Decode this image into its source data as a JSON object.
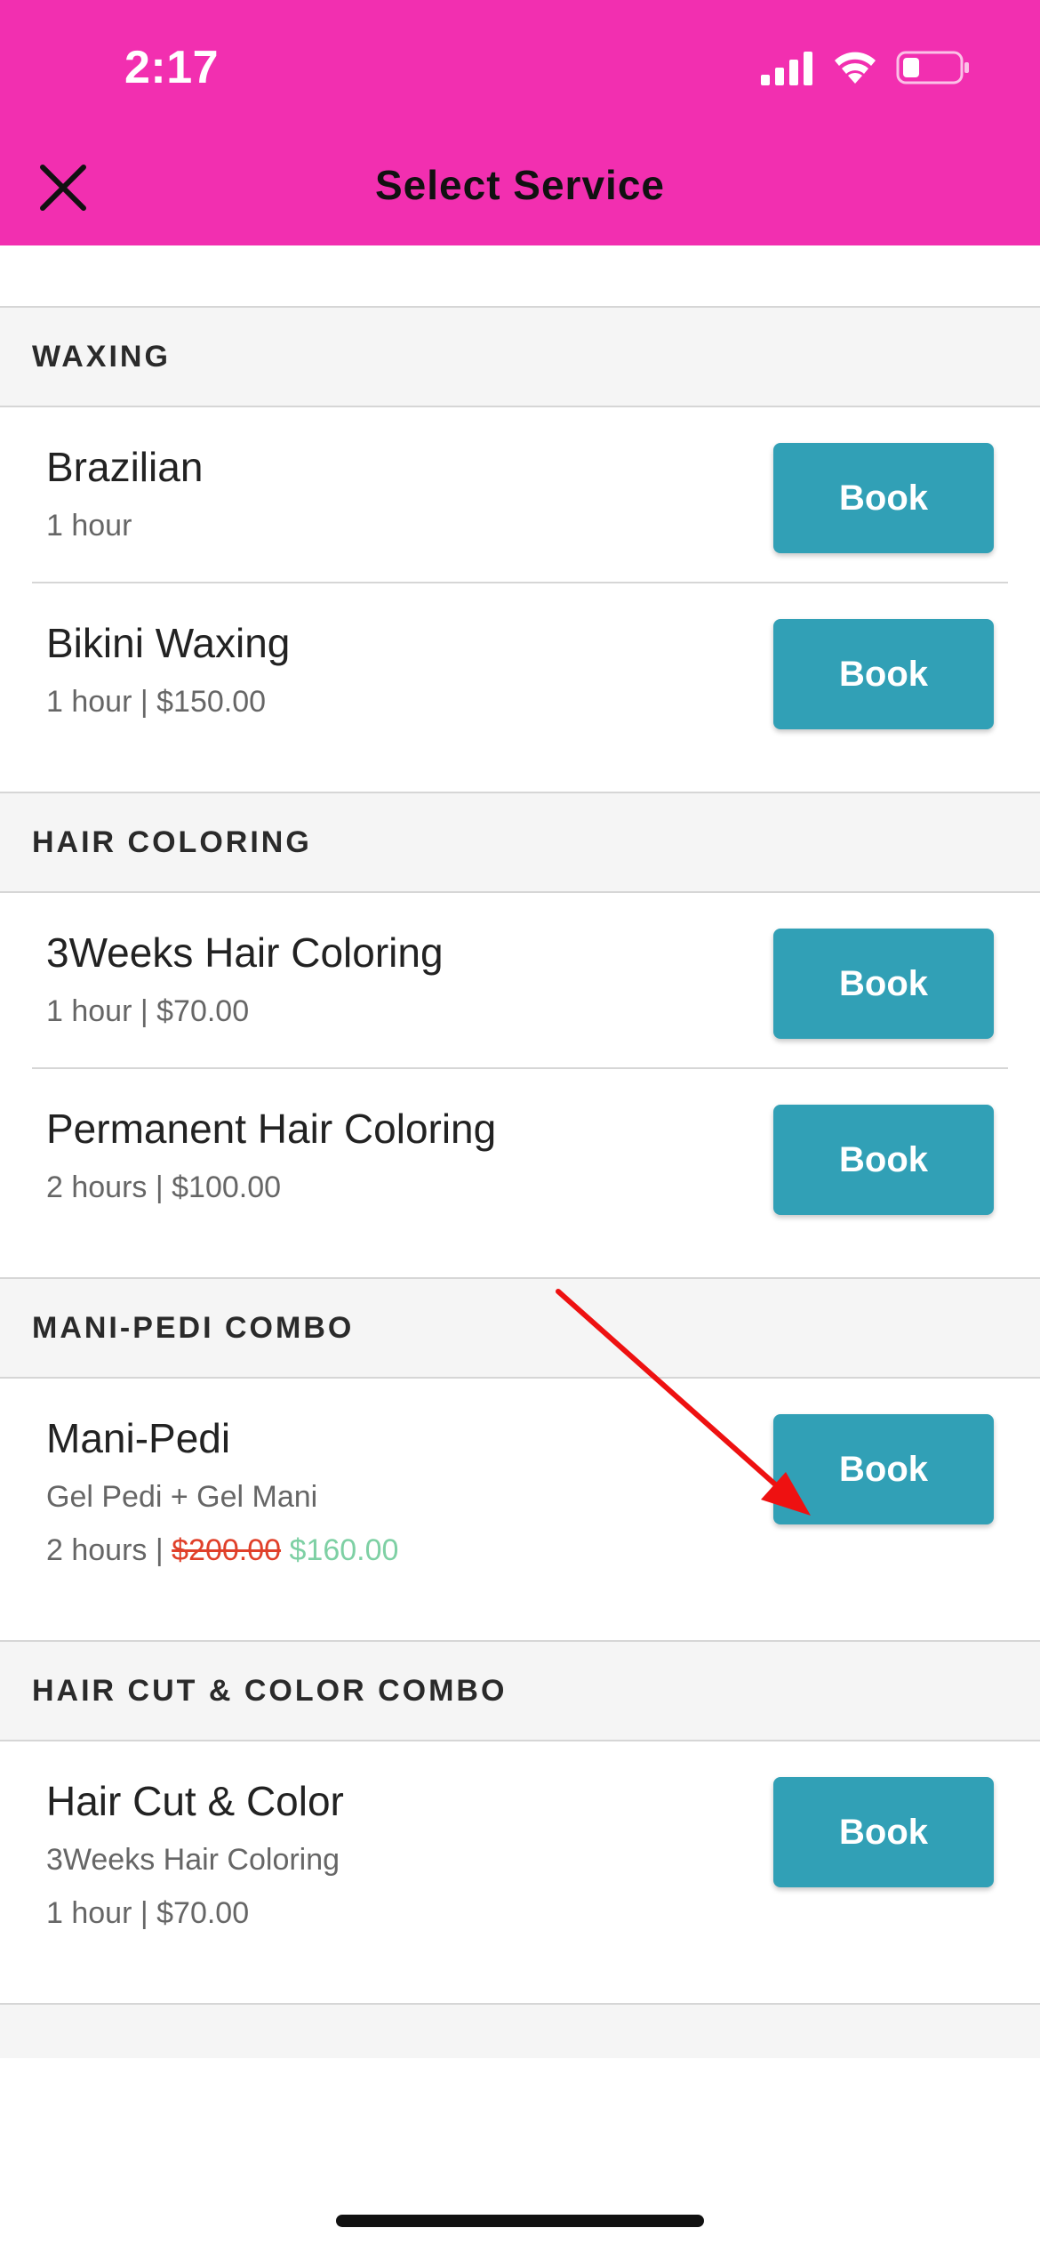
{
  "status_bar": {
    "time": "2:17"
  },
  "header": {
    "title": "Select Service",
    "background": "#f22fb0",
    "close_icon": "close-icon"
  },
  "colors": {
    "book_button": "#31a0b6",
    "price_strikethrough": "#e0402a",
    "price_sale": "#7ed0a4"
  },
  "sections": [
    {
      "title": "WAXING",
      "items": [
        {
          "name": "Brazilian",
          "detail": "1 hour",
          "button": "Book"
        },
        {
          "name": "Bikini Waxing",
          "detail": "1 hour | $150.00",
          "button": "Book"
        }
      ]
    },
    {
      "title": "HAIR COLORING",
      "items": [
        {
          "name": "3Weeks Hair Coloring",
          "detail": "1 hour | $70.00",
          "button": "Book"
        },
        {
          "name": "Permanent Hair Coloring",
          "detail": "2 hours | $100.00",
          "button": "Book"
        }
      ]
    },
    {
      "title": "MANI-PEDI COMBO",
      "items": [
        {
          "name": "Mani-Pedi",
          "description": "Gel Pedi + Gel Mani",
          "duration": "2 hours |",
          "old_price": "$200.00",
          "new_price": "$160.00",
          "button": "Book"
        }
      ]
    },
    {
      "title": "HAIR CUT & COLOR COMBO",
      "items": [
        {
          "name": "Hair Cut & Color",
          "description": "3Weeks Hair Coloring",
          "detail": "1 hour | $70.00",
          "button": "Book"
        }
      ]
    }
  ]
}
